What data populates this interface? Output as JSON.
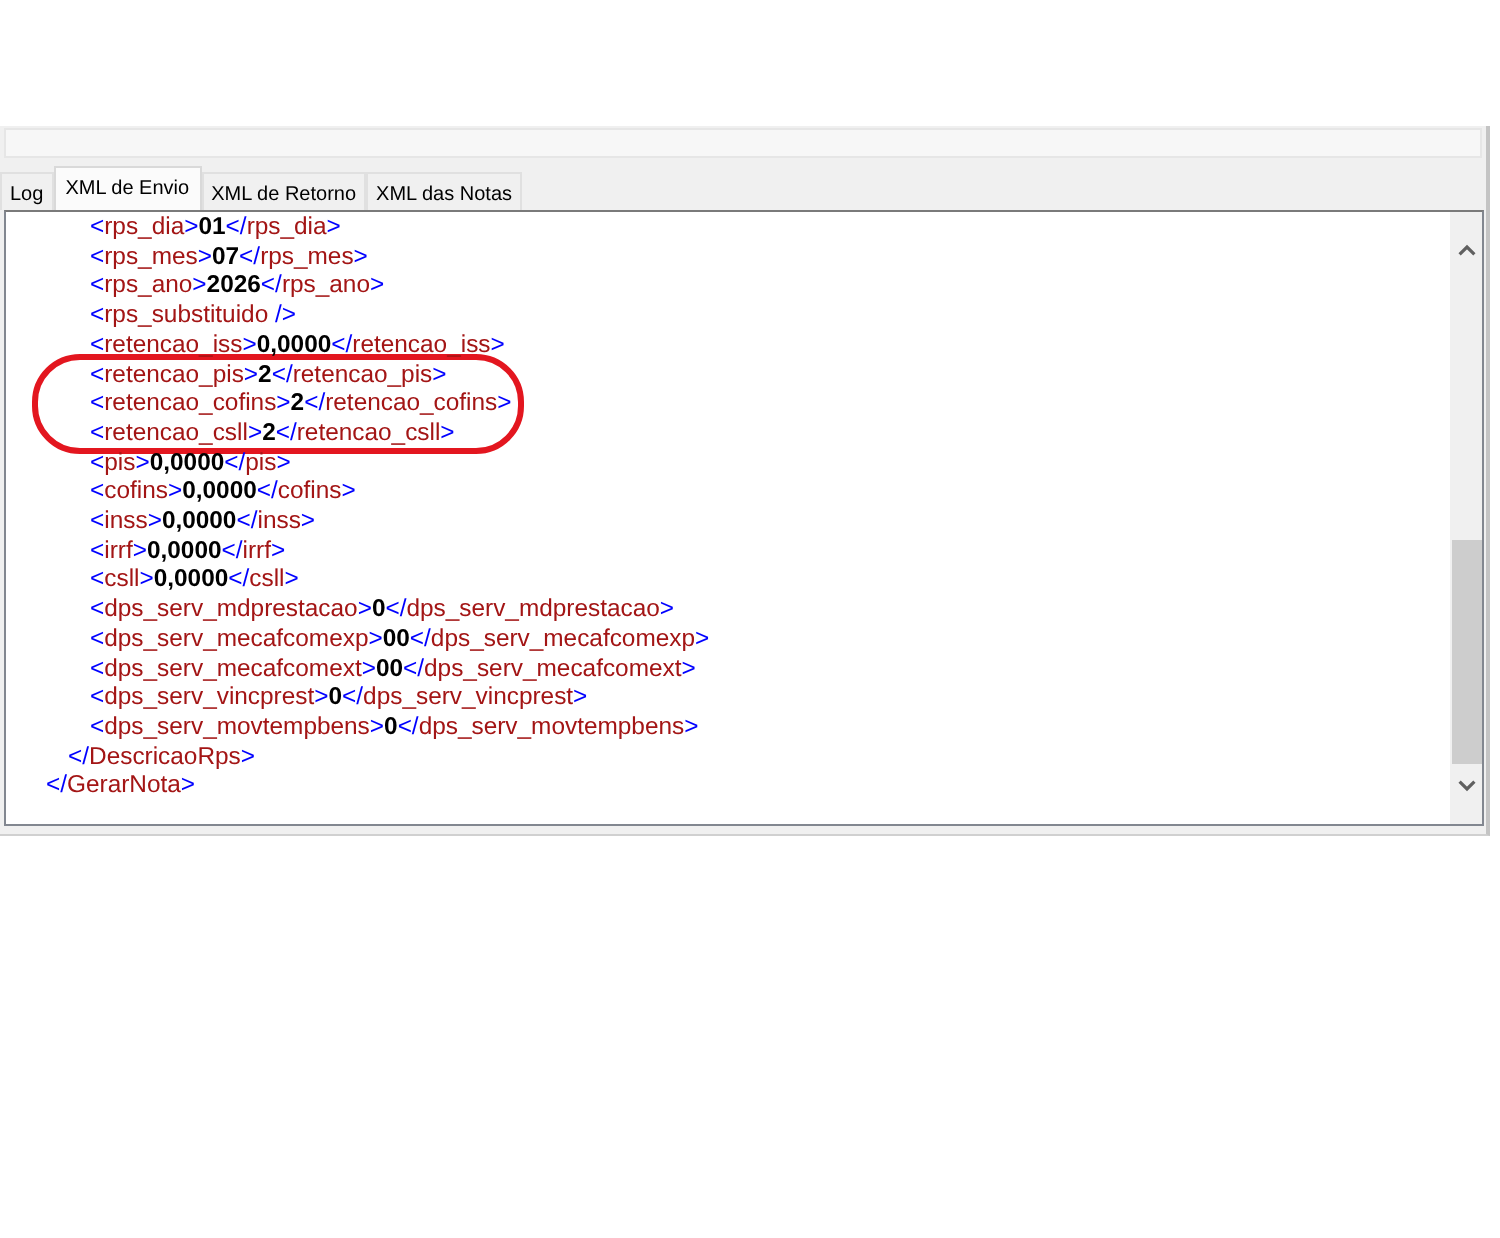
{
  "tabs": [
    {
      "label": "Log",
      "selected": false
    },
    {
      "label": "XML de Envio",
      "selected": true
    },
    {
      "label": "XML de Retorno",
      "selected": false
    },
    {
      "label": "XML das Notas",
      "selected": false
    }
  ],
  "xml_view": {
    "nodes": [
      {
        "kind": "container",
        "close": [
          "</",
          "GerarNota",
          ">"
        ],
        "children": [
          {
            "kind": "container",
            "close": [
              "</",
              "DescricaoRps",
              ">"
            ],
            "children": [
              {
                "kind": "element",
                "open": [
                  "<",
                  "rps_dia",
                  ">"
                ],
                "value": "01",
                "close": [
                  "</",
                  "rps_dia",
                  ">"
                ],
                "circled": false
              },
              {
                "kind": "element",
                "open": [
                  "<",
                  "rps_mes",
                  ">"
                ],
                "value": "07",
                "close": [
                  "</",
                  "rps_mes",
                  ">"
                ],
                "circled": false
              },
              {
                "kind": "element",
                "open": [
                  "<",
                  "rps_ano",
                  ">"
                ],
                "value": "2026",
                "close": [
                  "</",
                  "rps_ano",
                  ">"
                ],
                "circled": false
              },
              {
                "kind": "empty",
                "open": [
                  "<",
                  "rps_substituido",
                  " />"
                ],
                "circled": false
              },
              {
                "kind": "element",
                "open": [
                  "<",
                  "retencao_iss",
                  ">"
                ],
                "value": "0,0000",
                "close": [
                  "</",
                  "retencao_iss",
                  ">"
                ],
                "circled": false
              },
              {
                "kind": "element",
                "open": [
                  "<",
                  "retencao_pis",
                  ">"
                ],
                "value": "2",
                "close": [
                  "</",
                  "retencao_pis",
                  ">"
                ],
                "circled": true
              },
              {
                "kind": "element",
                "open": [
                  "<",
                  "retencao_cofins",
                  ">"
                ],
                "value": "2",
                "close": [
                  "</",
                  "retencao_cofins",
                  ">"
                ],
                "circled": true
              },
              {
                "kind": "element",
                "open": [
                  "<",
                  "retencao_csll",
                  ">"
                ],
                "value": "2",
                "close": [
                  "</",
                  "retencao_csll",
                  ">"
                ],
                "circled": true
              },
              {
                "kind": "element",
                "open": [
                  "<",
                  "pis",
                  ">"
                ],
                "value": "0,0000",
                "close": [
                  "</",
                  "pis",
                  ">"
                ],
                "circled": false
              },
              {
                "kind": "element",
                "open": [
                  "<",
                  "cofins",
                  ">"
                ],
                "value": "0,0000",
                "close": [
                  "</",
                  "cofins",
                  ">"
                ],
                "circled": false
              },
              {
                "kind": "element",
                "open": [
                  "<",
                  "inss",
                  ">"
                ],
                "value": "0,0000",
                "close": [
                  "</",
                  "inss",
                  ">"
                ],
                "circled": false
              },
              {
                "kind": "element",
                "open": [
                  "<",
                  "irrf",
                  ">"
                ],
                "value": "0,0000",
                "close": [
                  "</",
                  "irrf",
                  ">"
                ],
                "circled": false
              },
              {
                "kind": "element",
                "open": [
                  "<",
                  "csll",
                  ">"
                ],
                "value": "0,0000",
                "close": [
                  "</",
                  "csll",
                  ">"
                ],
                "circled": false
              },
              {
                "kind": "element",
                "open": [
                  "<",
                  "dps_serv_mdprestacao",
                  ">"
                ],
                "value": "0",
                "close": [
                  "</",
                  "dps_serv_mdprestacao",
                  ">"
                ],
                "circled": false
              },
              {
                "kind": "element",
                "open": [
                  "<",
                  "dps_serv_mecafcomexp",
                  ">"
                ],
                "value": "00",
                "close": [
                  "</",
                  "dps_serv_mecafcomexp",
                  ">"
                ],
                "circled": false
              },
              {
                "kind": "element",
                "open": [
                  "<",
                  "dps_serv_mecafcomext",
                  ">"
                ],
                "value": "00",
                "close": [
                  "</",
                  "dps_serv_mecafcomext",
                  ">"
                ],
                "circled": false
              },
              {
                "kind": "element",
                "open": [
                  "<",
                  "dps_serv_vincprest",
                  ">"
                ],
                "value": "0",
                "close": [
                  "</",
                  "dps_serv_vincprest",
                  ">"
                ],
                "circled": false
              },
              {
                "kind": "element",
                "open": [
                  "<",
                  "dps_serv_movtempbens",
                  ">"
                ],
                "value": "0",
                "close": [
                  "</",
                  "dps_serv_movtempbens",
                  ">"
                ],
                "circled": false
              }
            ]
          }
        ]
      }
    ]
  }
}
